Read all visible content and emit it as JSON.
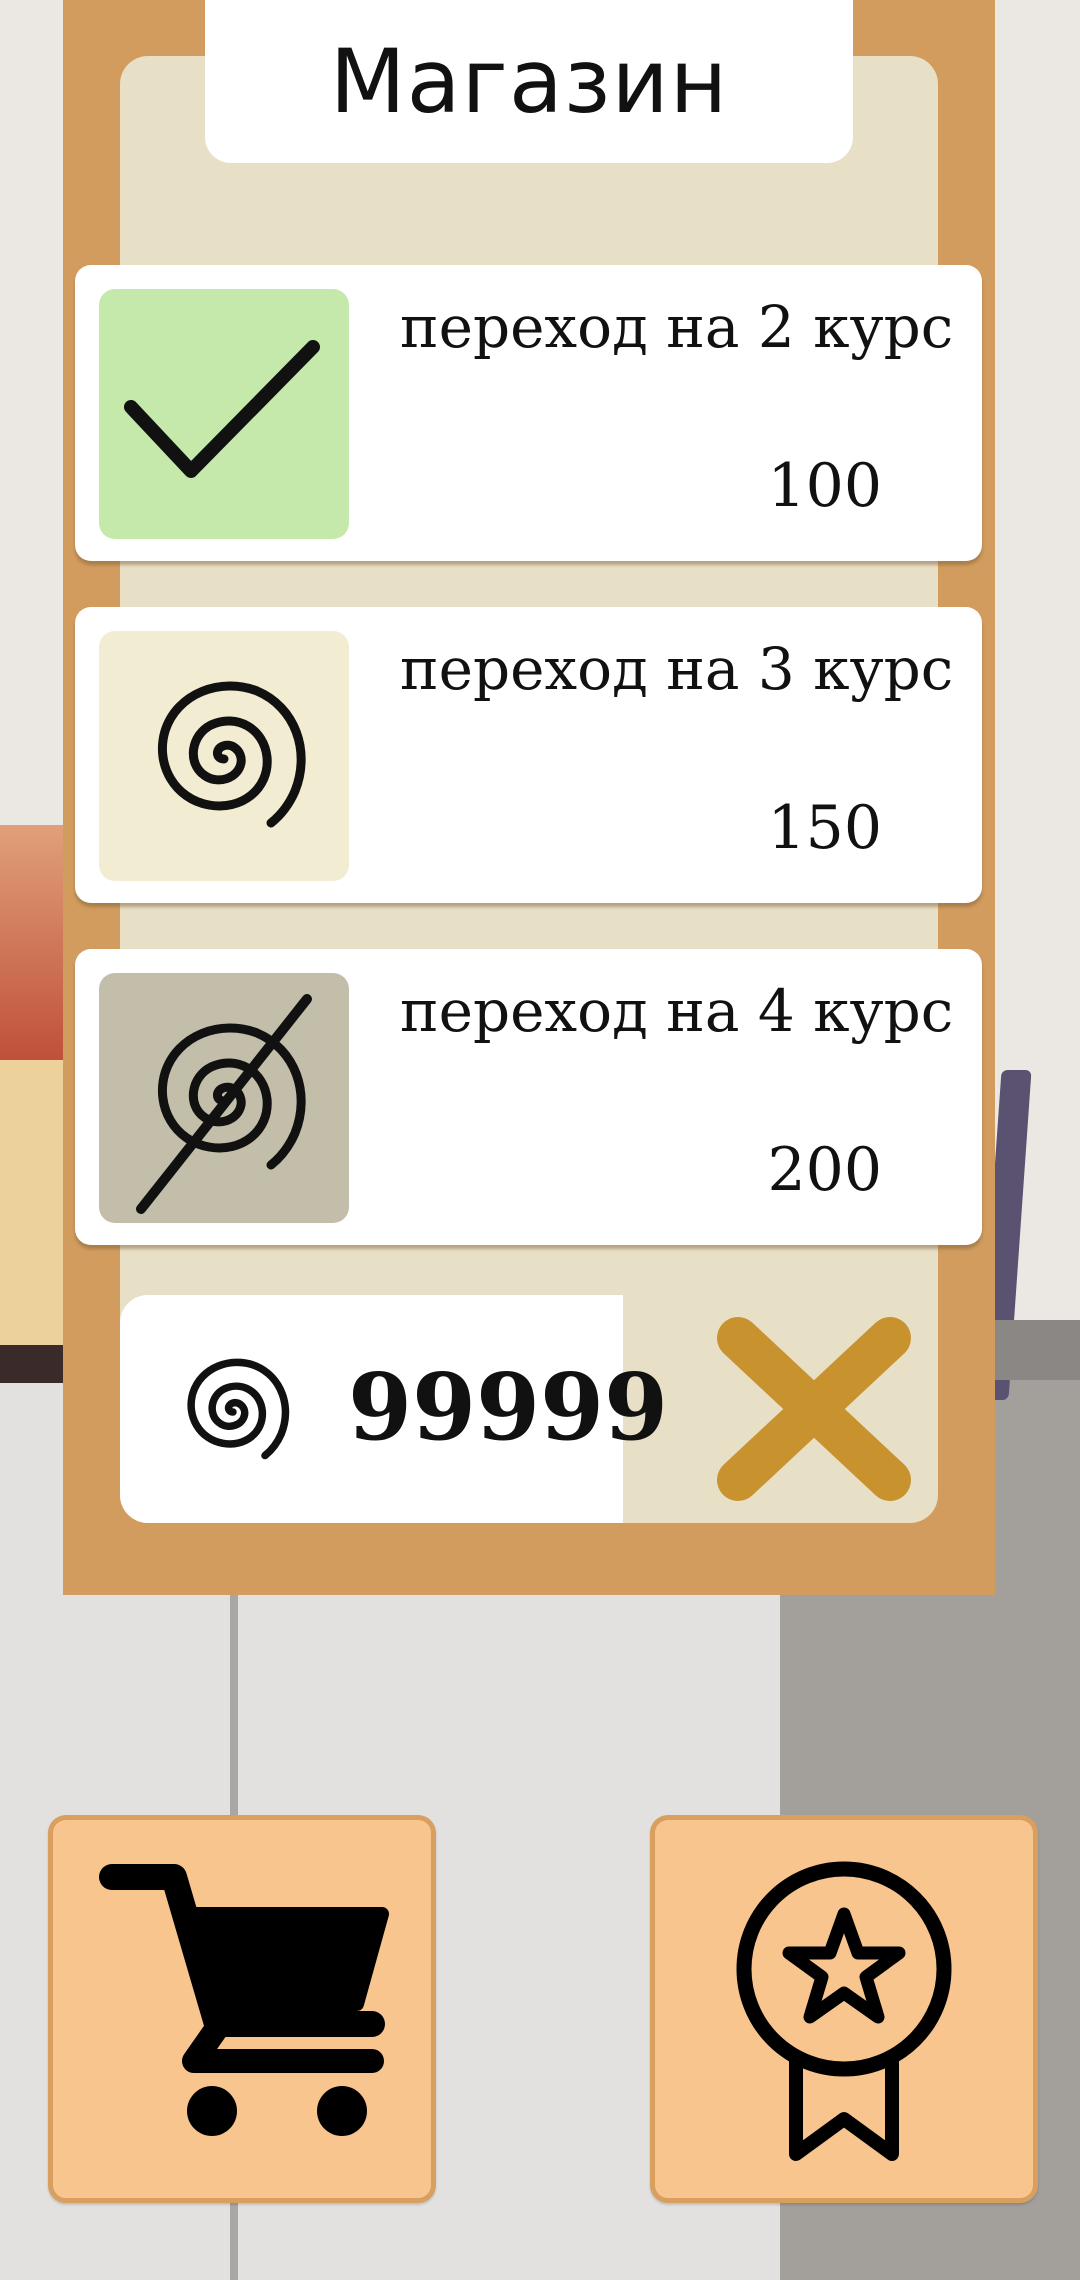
{
  "shop": {
    "title": "Магазин",
    "items": [
      {
        "label": "переход на 2 курс",
        "price": "100",
        "state": "purchased",
        "icon": "checkmark-icon",
        "thumb_color": "#c5e9ab"
      },
      {
        "label": "переход на 3 курс",
        "price": "150",
        "state": "available",
        "icon": "spiral-coin-icon",
        "thumb_color": "#f2ecd2"
      },
      {
        "label": "переход на 4 курс",
        "price": "200",
        "state": "locked",
        "icon": "spiral-crossed-icon",
        "thumb_color": "#c3bea9"
      }
    ],
    "balance": "99999",
    "close_icon": "close-x-icon"
  },
  "bottom_nav": [
    {
      "icon": "shopping-cart-icon"
    },
    {
      "icon": "award-ribbon-icon"
    }
  ],
  "colors": {
    "frame": "#d29c5e",
    "inner_panel": "#e8dfc7",
    "close_x": "#c8922f",
    "nav_button": "#f7c58d"
  }
}
